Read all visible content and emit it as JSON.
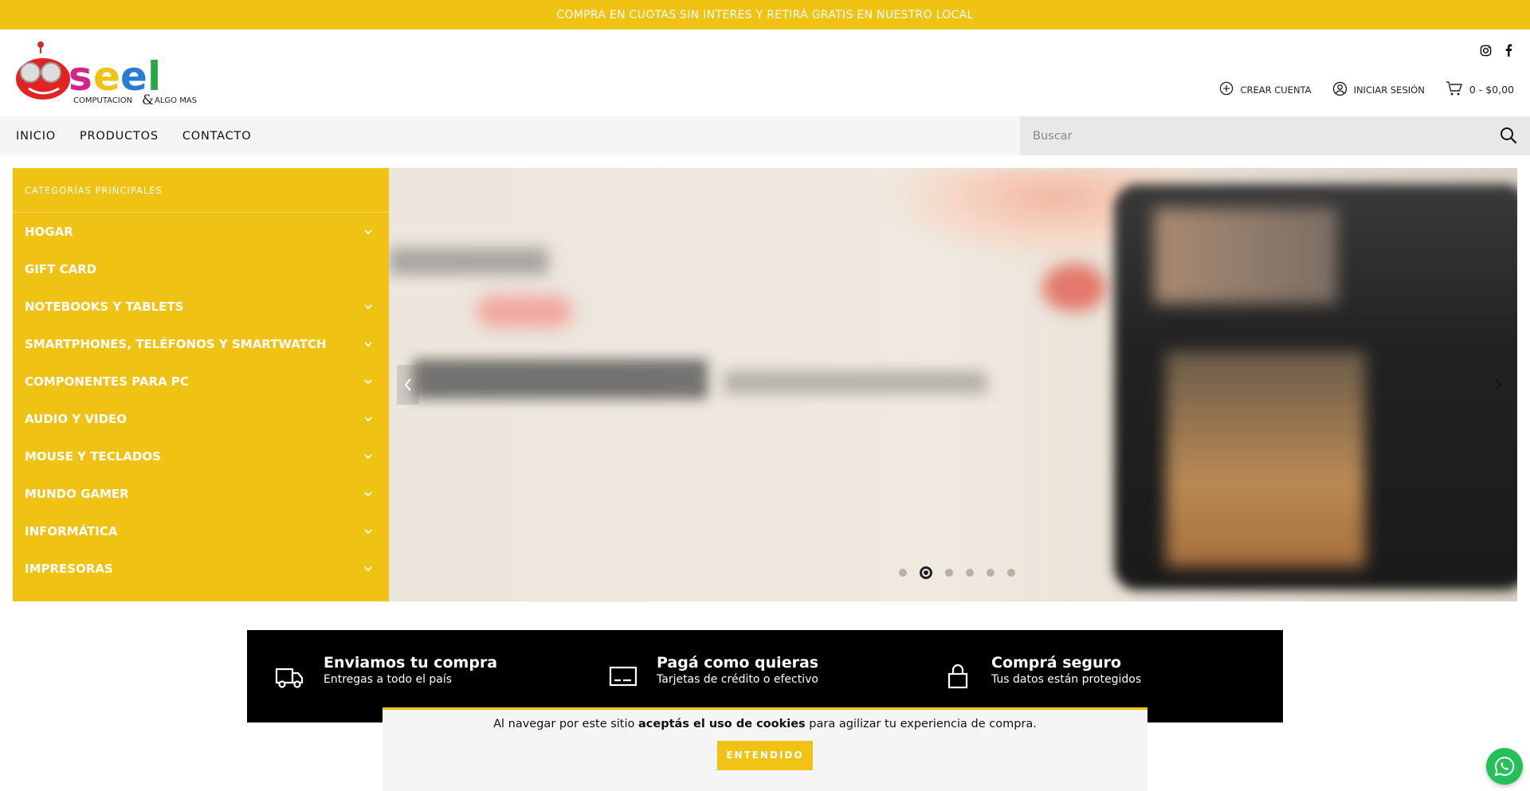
{
  "topbar": {
    "text": "COMPRA EN CUOTAS SIN INTERES Y RETIRÁ GRATIS EN NUESTRO LOCAL"
  },
  "logo": {
    "brand": "seel",
    "tagline_a": "COMPUTACION",
    "tagline_amp": "&",
    "tagline_b": "ALGO MAS"
  },
  "header": {
    "create_account": "CREAR CUENTA",
    "login": "INICIAR SESIÓN",
    "cart": "0 - $0,00"
  },
  "nav": {
    "items": [
      "INICIO",
      "PRODUCTOS",
      "CONTACTO"
    ]
  },
  "search": {
    "placeholder": "Buscar"
  },
  "sidebar": {
    "title": "CATEGORÍAS PRINCIPALES",
    "items": [
      {
        "label": "HOGAR",
        "expand": true
      },
      {
        "label": "GIFT CARD",
        "expand": false
      },
      {
        "label": "NOTEBOOKS Y TABLETS",
        "expand": true
      },
      {
        "label": "SMARTPHONES, TELÉFONOS Y SMARTWATCH",
        "expand": true
      },
      {
        "label": "COMPONENTES PARA PC",
        "expand": true
      },
      {
        "label": "AUDIO Y VIDEO",
        "expand": true
      },
      {
        "label": "MOUSE Y TECLADOS",
        "expand": true
      },
      {
        "label": "MUNDO GAMER",
        "expand": true
      },
      {
        "label": "INFORMÁTICA",
        "expand": true
      },
      {
        "label": "IMPRESORAS",
        "expand": true
      }
    ]
  },
  "slider": {
    "slide_count": 6,
    "active_index": 1
  },
  "features": [
    {
      "title": "Enviamos tu compra",
      "subtitle": "Entregas a todo el país",
      "icon": "truck-icon"
    },
    {
      "title": "Pagá como quieras",
      "subtitle": "Tarjetas de crédito o efectivo",
      "icon": "credit-card-icon"
    },
    {
      "title": "Comprá seguro",
      "subtitle": "Tus datos están protegidos",
      "icon": "lock-icon"
    }
  ],
  "cookie": {
    "pre": "Al navegar por este sitio ",
    "bold": "aceptás el uso de cookies",
    "post": " para agilizar tu experiencia de compra.",
    "button": "ENTENDIDO"
  },
  "colors": {
    "accent": "#f0c214",
    "dark": "#000000",
    "whatsapp": "#25c05a"
  }
}
